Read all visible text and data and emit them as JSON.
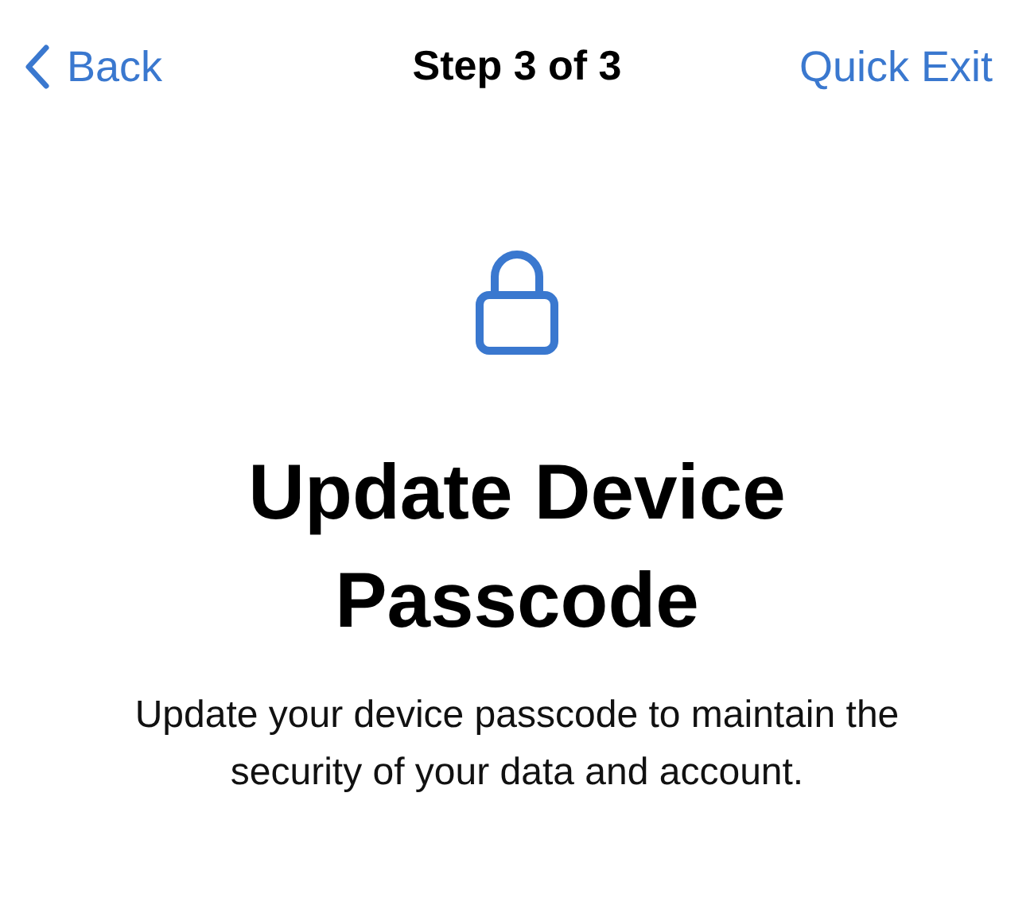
{
  "nav": {
    "back": "Back",
    "title": "Step 3 of 3",
    "action": "Quick Exit"
  },
  "heading": "Update Device Passcode",
  "description": "Update your device passcode to maintain the security of your data and account."
}
